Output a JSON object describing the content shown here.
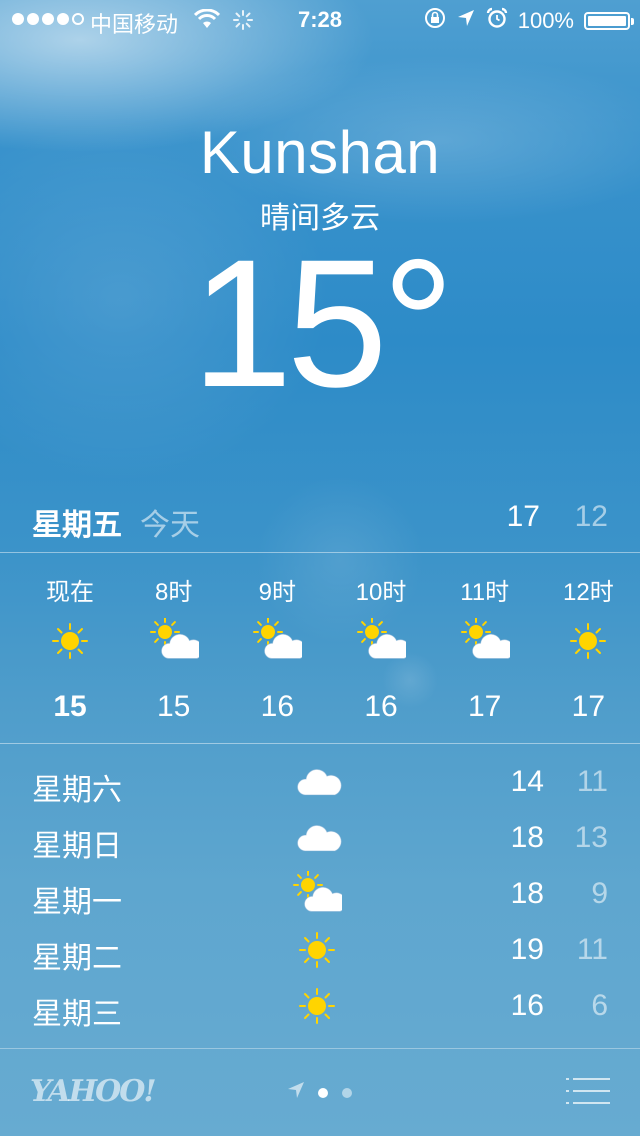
{
  "status_bar": {
    "carrier": "中国移动",
    "time": "7:28",
    "battery": "100%",
    "battery_level": 1.0,
    "signal_bars_filled": 4,
    "signal_bars_total": 5
  },
  "location": {
    "city": "Kunshan",
    "condition": "晴间多云",
    "temperature": "15",
    "degree_symbol": "°"
  },
  "today": {
    "day": "星期五",
    "label": "今天",
    "high": "17",
    "low": "12"
  },
  "hourly": [
    {
      "time": "现在",
      "icon": "sun-icon",
      "temp": "15"
    },
    {
      "time": "8时",
      "icon": "partly-cloudy-icon",
      "temp": "15"
    },
    {
      "time": "9时",
      "icon": "partly-cloudy-icon",
      "temp": "16"
    },
    {
      "time": "10时",
      "icon": "partly-cloudy-icon",
      "temp": "16"
    },
    {
      "time": "11时",
      "icon": "partly-cloudy-icon",
      "temp": "17"
    },
    {
      "time": "12时",
      "icon": "sun-icon",
      "temp": "17"
    }
  ],
  "daily": [
    {
      "day": "星期六",
      "icon": "cloud-icon",
      "high": "14",
      "low": "11"
    },
    {
      "day": "星期日",
      "icon": "cloud-icon",
      "high": "18",
      "low": "13"
    },
    {
      "day": "星期一",
      "icon": "partly-cloudy-icon",
      "high": "18",
      "low": "9"
    },
    {
      "day": "星期二",
      "icon": "sun-icon",
      "high": "19",
      "low": "11"
    },
    {
      "day": "星期三",
      "icon": "sun-icon",
      "high": "16",
      "low": "6"
    }
  ],
  "bottom_bar": {
    "logo": "YAHOO!",
    "page_count": 2,
    "active_page": 1
  },
  "colors": {
    "sun": "#ffd400",
    "cloud": "#ffffff",
    "sky_top": "#4f9fd1",
    "sky_bottom": "#67abd1"
  }
}
